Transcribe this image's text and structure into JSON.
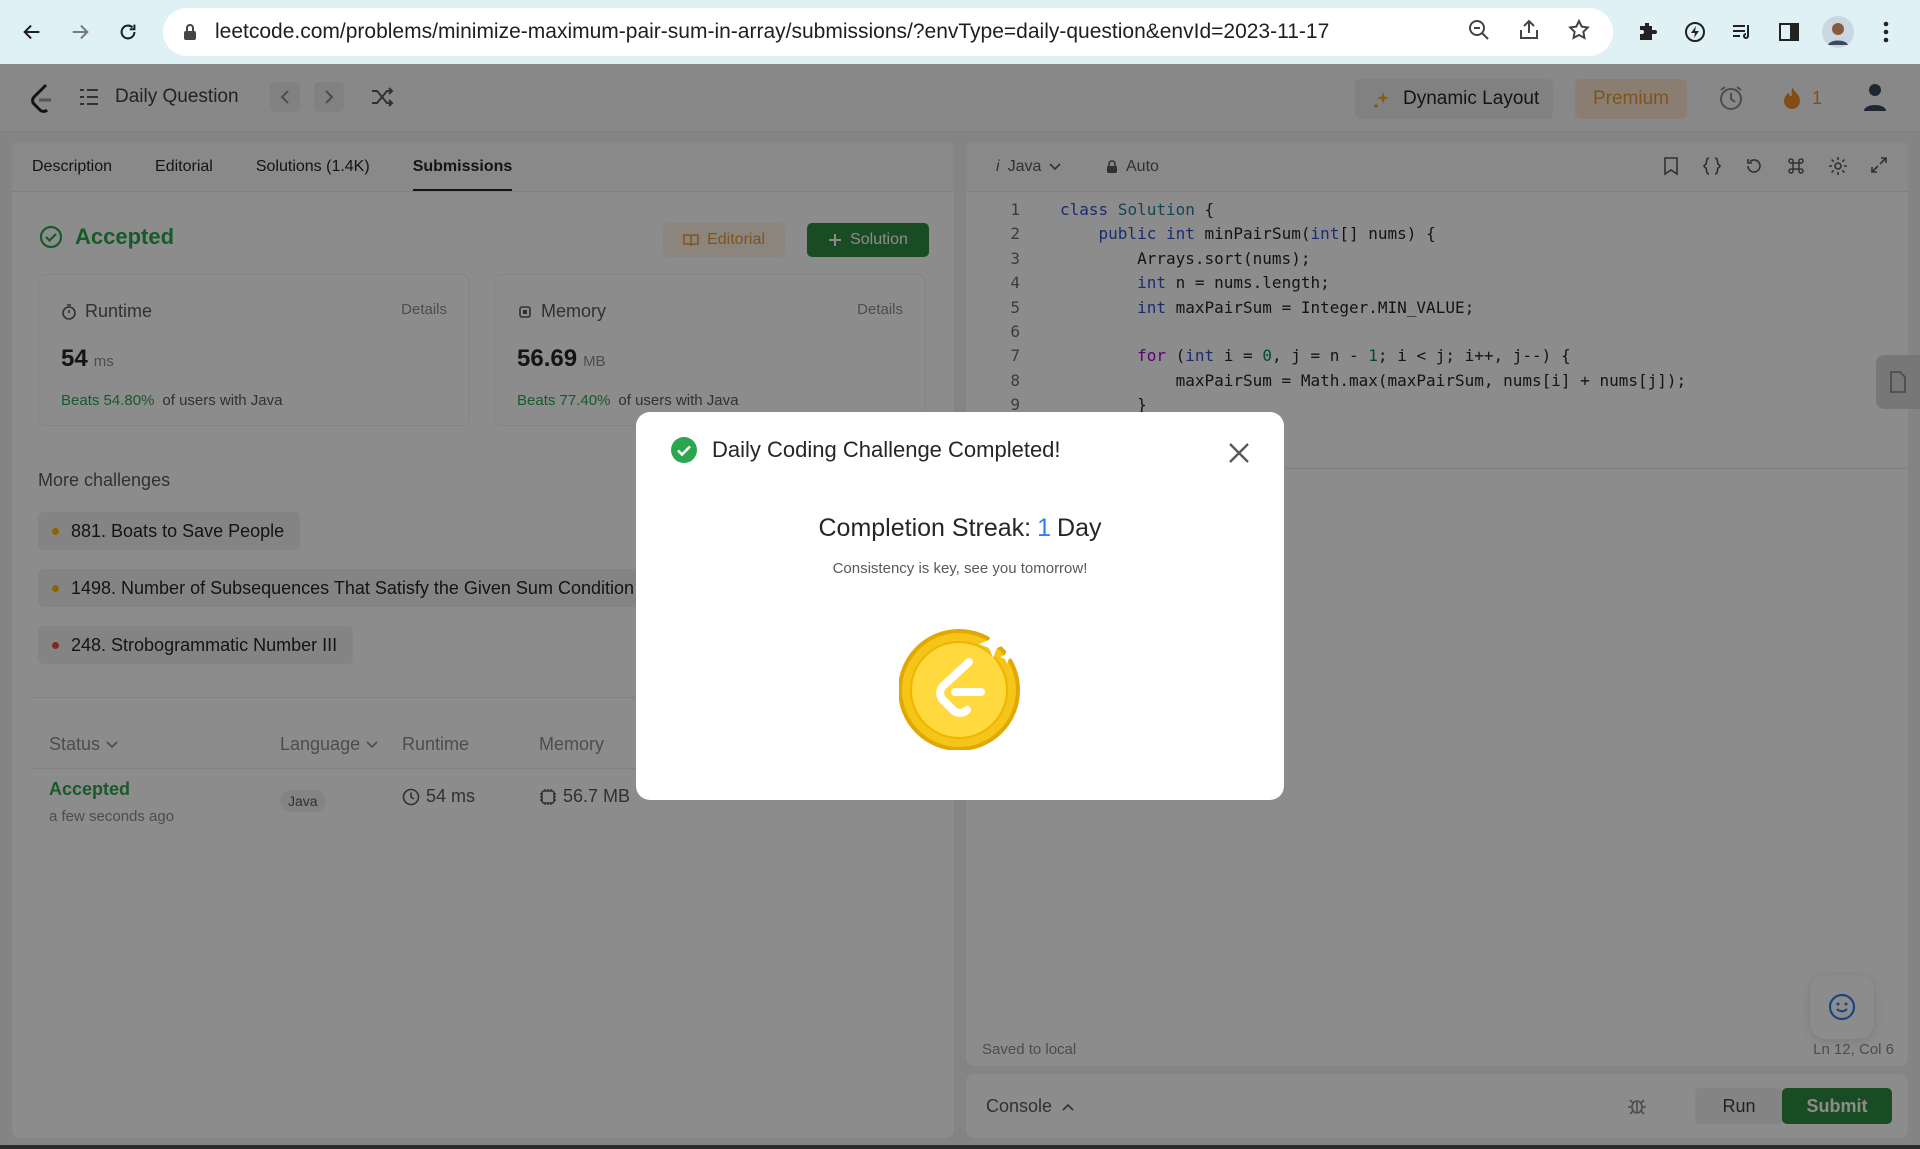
{
  "browser": {
    "url": "leetcode.com/problems/minimize-maximum-pair-sum-in-array/submissions/?envType=daily-question&envId=2023-11-17"
  },
  "header": {
    "daily_question_label": "Daily Question",
    "dynamic_layout_label": "Dynamic Layout",
    "premium_label": "Premium",
    "streak_count": "1"
  },
  "left": {
    "tabs": [
      "Description",
      "Editorial",
      "Solutions (1.4K)",
      "Submissions"
    ],
    "active_tab": "Submissions",
    "result_title": "Accepted",
    "editorial_btn": "Editorial",
    "solution_btn": "Solution",
    "runtime": {
      "label": "Runtime",
      "details": "Details",
      "value": "54",
      "unit": "ms",
      "beats": "Beats 54.80%",
      "beats_suffix": "of users with Java"
    },
    "memory": {
      "label": "Memory",
      "details": "Details",
      "value": "56.69",
      "unit": "MB",
      "beats": "Beats 77.40%",
      "beats_suffix": "of users with Java"
    },
    "more_challenges_title": "More challenges",
    "challenges": [
      {
        "label": "881. Boats to Save People",
        "difficulty_color": "#ffb800"
      },
      {
        "label": "1498. Number of Subsequences That Satisfy the Given Sum Condition",
        "difficulty_color": "#ffb800"
      },
      {
        "label": "248. Strobogrammatic Number III",
        "difficulty_color": "#ef4743"
      }
    ],
    "table": {
      "headers": [
        "Status",
        "Language",
        "Runtime",
        "Memory"
      ],
      "row": {
        "status": "Accepted",
        "time": "a few seconds ago",
        "language": "Java",
        "runtime": "54 ms",
        "memory": "56.7 MB"
      }
    }
  },
  "editor": {
    "language": "Java",
    "mode": "Auto",
    "line_numbers": [
      "1",
      "2",
      "3",
      "4",
      "5",
      "6",
      "7",
      "8",
      "9"
    ],
    "visible_tail": ";",
    "saved_label": "Saved to local",
    "cursor_pos": "Ln 12, Col 6"
  },
  "console": {
    "label": "Console",
    "run": "Run",
    "submit": "Submit"
  },
  "modal": {
    "title": "Daily Coding Challenge Completed!",
    "streak_prefix": "Completion Streak:",
    "streak_value": "1",
    "streak_suffix": "Day",
    "subtitle": "Consistency is key, see you tomorrow!"
  },
  "colors": {
    "accent_green": "#2da44e",
    "submit_green": "#2e8b3f",
    "premium_orange": "#e39a3b",
    "streak_blue": "#2f80ed",
    "coin_gold": "#f5c518"
  }
}
